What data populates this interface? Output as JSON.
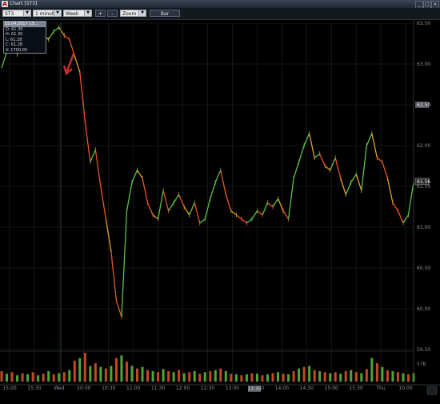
{
  "window": {
    "title": "Chart [ST3]",
    "app_icon": "A"
  },
  "toolbar": {
    "symbol": "ST3",
    "interval": "1 minute",
    "range": "Week",
    "plus_label": "+",
    "minus_label": "-",
    "zoom_label": "Zoom",
    "bar_label": "Bar"
  },
  "info_box": {
    "datetime": "15.04.2017 13:...",
    "open": "O: 61.30",
    "high": "H: 61.30",
    "low": "L: 61.28",
    "close": "C: 61.28",
    "volume": "V: 1700.00"
  },
  "colors": {
    "up": "#5cc243",
    "down": "#e8552a",
    "mid": "#e0a030",
    "grid": "#1e2a20",
    "axis_text": "#8a8f96",
    "arrow": "#c03030"
  },
  "price_axis": {
    "labels": [
      "63.50",
      "63.00",
      "62.50",
      "62.00",
      "61.50",
      "61.00",
      "60.50",
      "60.00",
      "59.50"
    ],
    "current_marker": "62.50",
    "last_price": "61.56",
    "last_price_color": "#f0f0f0"
  },
  "volume_axis": {
    "label": "57K"
  },
  "time_axis": {
    "labels": [
      "15:00",
      "15:30",
      "Wed",
      "10:00",
      "10:30",
      "11:00",
      "11:30",
      "12:00",
      "12:30",
      "13:00",
      "13:30",
      "14:00",
      "14:30",
      "15:00",
      "15:30",
      "Thu",
      "10:00"
    ],
    "cursor_label": "13:35"
  },
  "chart_data": {
    "type": "line",
    "series": [
      {
        "values": [
          62.95,
          63.15,
          63.25,
          63.12,
          63.28,
          63.2,
          63.3,
          63.25,
          63.35,
          63.3,
          63.4,
          63.45,
          63.35,
          63.3,
          63.1,
          62.9,
          62.3,
          61.8,
          61.95,
          61.5,
          61.1,
          60.7,
          60.1,
          59.9,
          61.2,
          61.55,
          61.7,
          61.6,
          61.3,
          61.15,
          61.1,
          61.45,
          61.2,
          61.3,
          61.4,
          61.25,
          61.15,
          61.3,
          61.05,
          61.1,
          61.35,
          61.55,
          61.7,
          61.4,
          61.2,
          61.15,
          61.1,
          61.05,
          61.1,
          61.2,
          61.15,
          61.3,
          61.25,
          61.35,
          61.2,
          61.1,
          61.6,
          61.8,
          62.0,
          62.15,
          61.85,
          61.9,
          61.75,
          61.7,
          61.85,
          61.6,
          61.4,
          61.55,
          61.65,
          61.45,
          62.0,
          62.15,
          61.85,
          61.8,
          61.6,
          61.3,
          61.2,
          61.05,
          61.15,
          61.55
        ]
      }
    ],
    "ylim": [
      59.5,
      63.5
    ],
    "volume": [
      20,
      15,
      18,
      12,
      16,
      14,
      18,
      12,
      15,
      20,
      14,
      16,
      18,
      22,
      40,
      45,
      55,
      30,
      35,
      28,
      25,
      30,
      45,
      50,
      38,
      30,
      25,
      28,
      22,
      20,
      18,
      24,
      20,
      18,
      22,
      16,
      18,
      20,
      15,
      18,
      20,
      22,
      25,
      20,
      15,
      14,
      12,
      14,
      16,
      15,
      12,
      14,
      16,
      18,
      15,
      14,
      20,
      25,
      28,
      30,
      22,
      20,
      18,
      16,
      18,
      15,
      20,
      22,
      18,
      16,
      24,
      45,
      35,
      28,
      22,
      20,
      18,
      16,
      14,
      16
    ]
  }
}
